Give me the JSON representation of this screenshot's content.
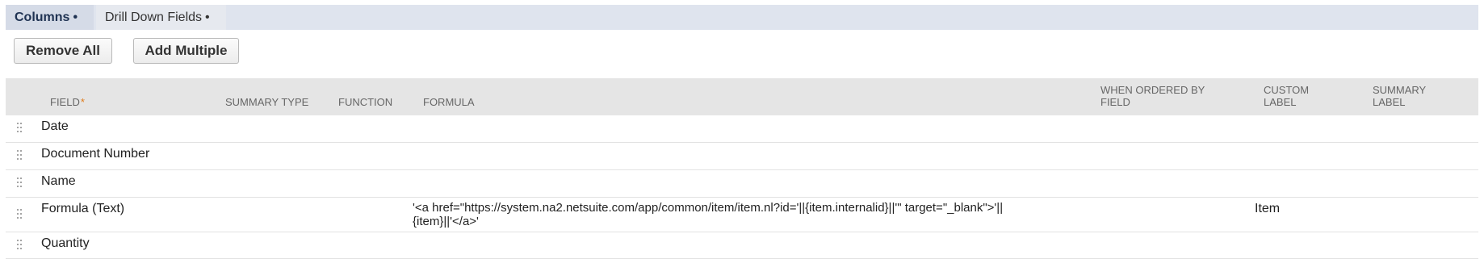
{
  "tabs": [
    {
      "label": "Columns",
      "indicator": "•",
      "active": true
    },
    {
      "label": "Drill Down Fields",
      "indicator": "•",
      "active": false
    }
  ],
  "buttons": {
    "remove_all": "Remove All",
    "add_multiple": "Add Multiple"
  },
  "table": {
    "headers": {
      "field": "FIELD",
      "field_required": "*",
      "summary_type": "SUMMARY TYPE",
      "function": "FUNCTION",
      "formula": "FORMULA",
      "when_ordered_by_field": "WHEN ORDERED BY FIELD",
      "custom_label": "CUSTOM LABEL",
      "summary_label": "SUMMARY LABEL"
    },
    "rows": [
      {
        "field": "Date",
        "formula": "",
        "custom_label": ""
      },
      {
        "field": "Document Number",
        "formula": "",
        "custom_label": ""
      },
      {
        "field": "Name",
        "formula": "",
        "custom_label": ""
      },
      {
        "field": "Formula (Text)",
        "formula": "'<a href=\"https://system.na2.netsuite.com/app/common/item/item.nl?id='||{item.internalid}||'\" target=\"_blank\">'||{item}||'</a>'",
        "custom_label": "Item"
      },
      {
        "field": "Quantity",
        "formula": "",
        "custom_label": ""
      }
    ]
  },
  "colors": {
    "tabbar_bg": "#dfe4ee",
    "active_tab_text": "#1f3252",
    "header_bg": "#e5e5e5",
    "required_marker": "#e07b1a"
  },
  "icons": {
    "drag_handle": "drag-handle-icon"
  }
}
